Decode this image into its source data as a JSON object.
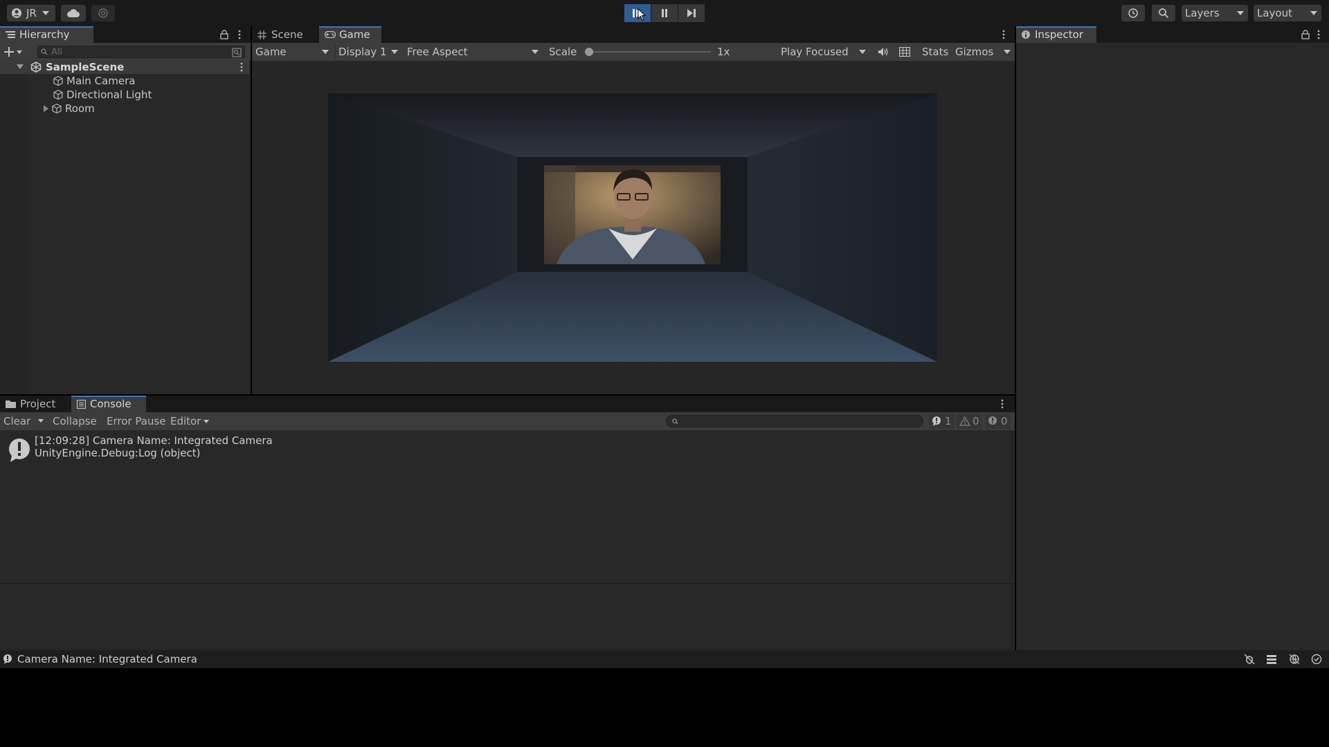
{
  "toolbar": {
    "account_label": "JR",
    "layers_label": "Layers",
    "layout_label": "Layout",
    "play_active": true
  },
  "hierarchy": {
    "tab_label": "Hierarchy",
    "search_placeholder": "All",
    "scene_name": "SampleScene",
    "items": [
      {
        "label": "Main Camera",
        "icon": "gameobject-icon",
        "expandable": false
      },
      {
        "label": "Directional Light",
        "icon": "gameobject-icon",
        "expandable": false
      },
      {
        "label": "Room",
        "icon": "gameobject-icon",
        "expandable": true
      }
    ]
  },
  "center": {
    "tabs": [
      {
        "label": "Scene",
        "selected": false,
        "icon": "grid-icon"
      },
      {
        "label": "Game",
        "selected": true,
        "icon": "gamepad-icon"
      }
    ],
    "game_toolbar": {
      "view_mode": "Game",
      "display": "Display 1",
      "aspect": "Free Aspect",
      "scale_label": "Scale",
      "scale_value": "1x",
      "scale_level": 0,
      "play_mode": "Play Focused",
      "stats_label": "Stats",
      "gizmos_label": "Gizmos"
    }
  },
  "inspector": {
    "tab_label": "Inspector"
  },
  "bottom": {
    "tabs": [
      {
        "label": "Project",
        "selected": false,
        "icon": "folder-icon"
      },
      {
        "label": "Console",
        "selected": true,
        "icon": "console-icon"
      }
    ],
    "console_toolbar": {
      "clear_label": "Clear",
      "collapse_label": "Collapse",
      "error_pause_label": "Error Pause",
      "editor_label": "Editor",
      "log_count": "1",
      "warning_count": "0",
      "error_count": "0"
    },
    "log_entries": [
      {
        "line1": "[12:09:28] Camera Name: Integrated Camera",
        "line2": "UnityEngine.Debug:Log (object)",
        "type": "info"
      }
    ]
  },
  "status_bar": {
    "message": "Camera Name: Integrated Camera"
  },
  "colors": {
    "accent": "#3a79bb",
    "play_active": "#2f5d94",
    "panel": "#282828",
    "toolbar": "#191919"
  }
}
